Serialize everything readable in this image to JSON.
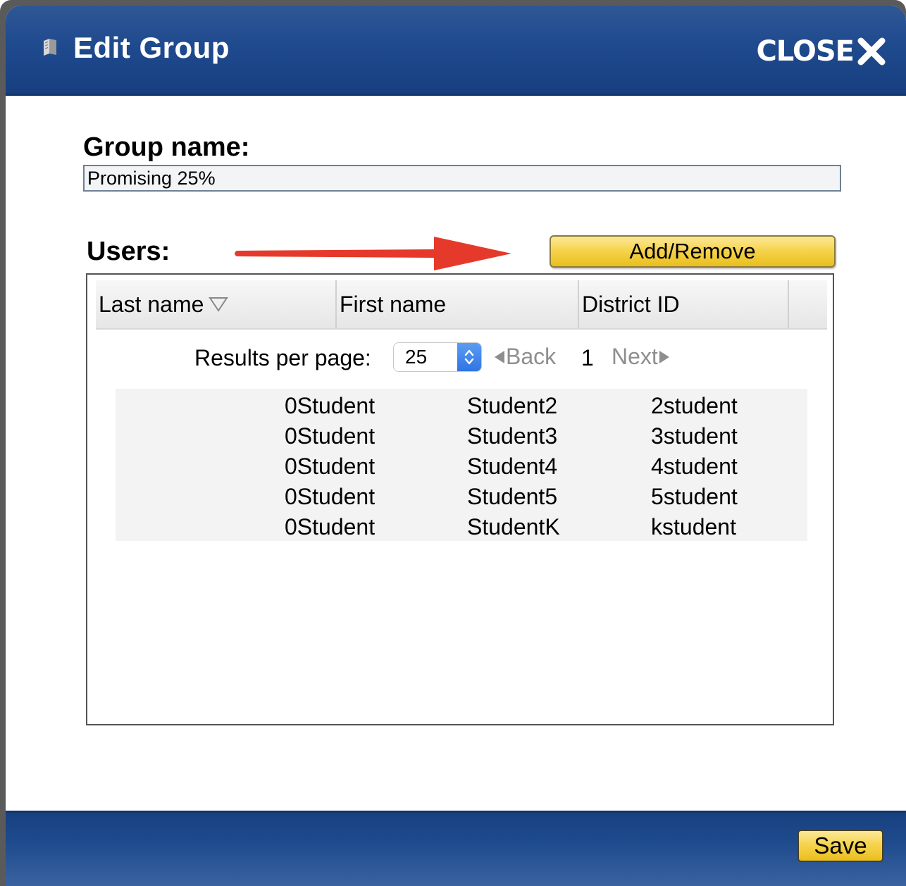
{
  "dialog": {
    "title": "Edit Group",
    "close_label": "CLOSE"
  },
  "group": {
    "label": "Group name:",
    "value": "Promising 25%"
  },
  "users": {
    "label": "Users:",
    "add_remove_label": "Add/Remove",
    "columns": [
      "Last name",
      "First name",
      "District ID"
    ],
    "sort": "descending",
    "rows": [
      {
        "last": "0Student",
        "first": "Student2",
        "district_id": "2student"
      },
      {
        "last": "0Student",
        "first": "Student3",
        "district_id": "3student"
      },
      {
        "last": "0Student",
        "first": "Student4",
        "district_id": "4student"
      },
      {
        "last": "0Student",
        "first": "Student5",
        "district_id": "5student"
      },
      {
        "last": "0Student",
        "first": "StudentK",
        "district_id": "kstudent"
      }
    ]
  },
  "pager": {
    "results_label": "Results per page:",
    "per_page": "25",
    "back_label": "Back",
    "current_page": "1",
    "next_label": "Next"
  },
  "footer": {
    "save_label": "Save"
  },
  "colors": {
    "header_blue": "#1f4a8e",
    "button_gold": "#f6d44e",
    "annotation_arrow": "#e53a2b"
  },
  "icons": {
    "header": "book-icon",
    "close": "close-x-icon",
    "sort": "sort-down-triangle-icon",
    "select": "updown-chevron-icon"
  }
}
